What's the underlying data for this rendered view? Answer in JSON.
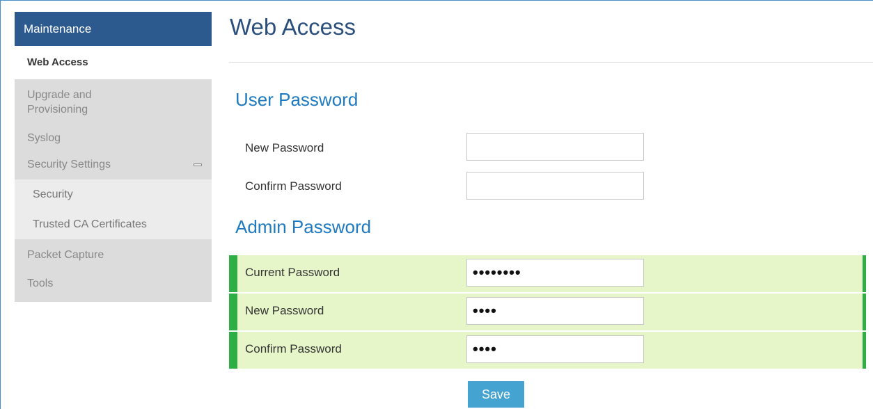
{
  "sidebar": {
    "header": "Maintenance",
    "active_item": "Web Access",
    "items": [
      {
        "label": "Upgrade and Provisioning"
      },
      {
        "label": "Syslog"
      },
      {
        "label": "Security Settings"
      },
      {
        "label": "Security"
      },
      {
        "label": "Trusted CA Certificates"
      },
      {
        "label": "Packet Capture"
      },
      {
        "label": "Tools"
      }
    ],
    "upgrade_line1": "Upgrade and",
    "upgrade_line2": "Provisioning"
  },
  "main": {
    "title": "Web Access",
    "user_section": {
      "title": "User Password",
      "new_password_label": "New Password",
      "new_password_value": "",
      "confirm_password_label": "Confirm Password",
      "confirm_password_value": ""
    },
    "admin_section": {
      "title": "Admin Password",
      "current_password_label": "Current Password",
      "current_password_value": "••••••••",
      "new_password_label": "New Password",
      "new_password_value": "••••",
      "confirm_password_label": "Confirm Password",
      "confirm_password_value": "••••"
    },
    "save_label": "Save"
  },
  "colors": {
    "sidebar_header_bg": "#2d5a8e",
    "title": "#2a4f7c",
    "section_title": "#1f7ac0",
    "highlight_bg": "#e6f6c9",
    "highlight_border": "#2eaf45",
    "save_button": "#45a3d1"
  }
}
